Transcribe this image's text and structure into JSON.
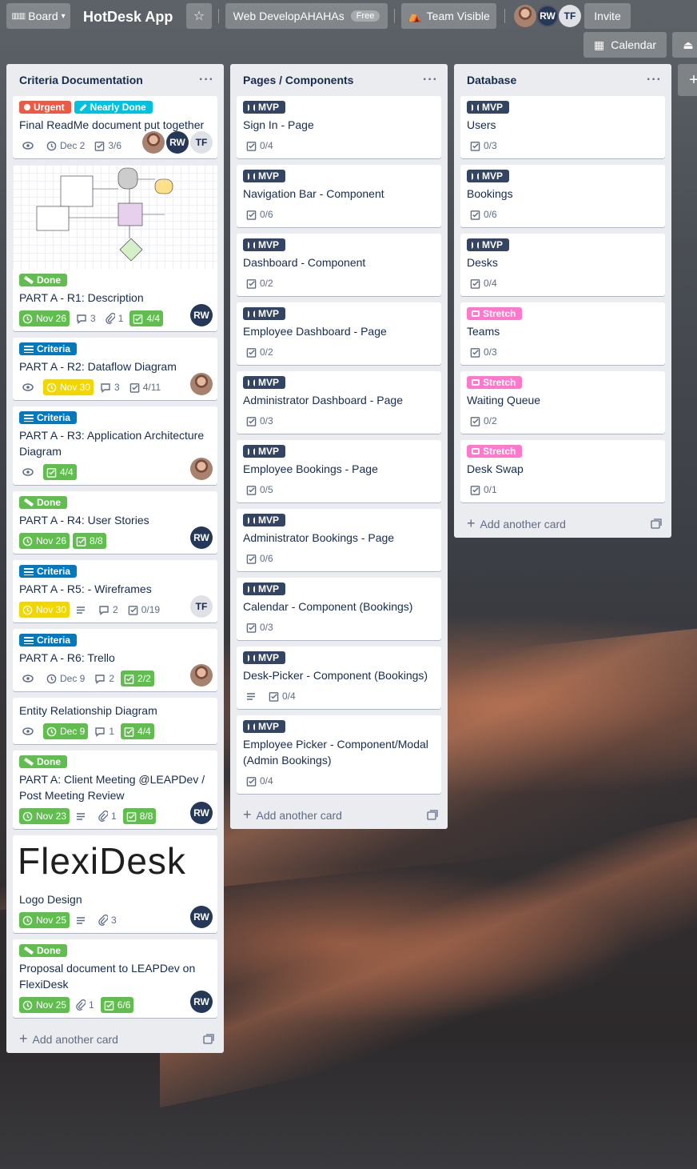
{
  "header": {
    "board_switcher": "Board",
    "board_title": "HotDesk App",
    "workspace": "Web DevelopAHAHAs",
    "workspace_badge": "Free",
    "visibility": "Team Visible",
    "members": [
      "RW",
      "TF"
    ],
    "invite": "Invite",
    "calendar": "Calendar"
  },
  "lists": [
    {
      "title": "Criteria Documentation",
      "add_card": "Add another card",
      "cards": [
        {
          "labels": [
            {
              "text": "Urgent",
              "color": "#eb5a46"
            },
            {
              "text": "Nearly Done",
              "color": "#00c2e0"
            }
          ],
          "title": "Final ReadMe document put together",
          "due": "Dec 2",
          "checklist": "3/6",
          "members": [
            "photo",
            "RW",
            "TF"
          ]
        },
        {
          "cover": "diagram",
          "labels": [
            {
              "text": "Done",
              "color": "#61bd4f"
            }
          ],
          "title": "PART A - R1: Description",
          "due": "Nov 26",
          "comments": "3",
          "attachments": "1",
          "checklist": "4/4",
          "members": [
            "RW"
          ]
        },
        {
          "labels": [
            {
              "text": "Criteria",
              "color": "#0079bf"
            }
          ],
          "title": "PART A - R2: Dataflow Diagram",
          "due": "Nov 30",
          "comments": "3",
          "checklist": "4/11",
          "members": [
            "photo"
          ]
        },
        {
          "labels": [
            {
              "text": "Criteria",
              "color": "#0079bf"
            }
          ],
          "title": "PART A - R3: Application Architecture Diagram",
          "checklist": "4/4",
          "members": [
            "photo"
          ]
        },
        {
          "labels": [
            {
              "text": "Done",
              "color": "#61bd4f"
            }
          ],
          "title": "PART A - R4: User Stories",
          "due": "Nov 26",
          "checklist": "8/8",
          "members": [
            "RW"
          ]
        },
        {
          "labels": [
            {
              "text": "Criteria",
              "color": "#0079bf"
            }
          ],
          "title": "PART A - R5: - Wireframes",
          "due": "Nov 30",
          "comments": "2",
          "checklist": "0/19",
          "members": [
            "TF"
          ]
        },
        {
          "labels": [
            {
              "text": "Criteria",
              "color": "#0079bf"
            }
          ],
          "title": "PART A - R6: Trello",
          "due": "Dec 9",
          "comments": "2",
          "checklist": "2/2",
          "members": [
            "photo"
          ]
        },
        {
          "title": "Entity Relationship Diagram",
          "due": "Dec 9",
          "comments": "1",
          "checklist": "4/4"
        },
        {
          "labels": [
            {
              "text": "Done",
              "color": "#61bd4f"
            }
          ],
          "title": "PART A: Client Meeting @LEAPDev / Post Meeting Review",
          "due": "Nov 23",
          "attachments": "1",
          "checklist": "8/8",
          "members": [
            "RW"
          ]
        },
        {
          "cover": "logo",
          "cover_text": "FlexiDesk",
          "title": "Logo Design",
          "due": "Nov 25",
          "attachments": "3",
          "members": [
            "RW"
          ]
        },
        {
          "labels": [
            {
              "text": "Done",
              "color": "#61bd4f"
            }
          ],
          "title": "Proposal document to LEAPDev on FlexiDesk",
          "due": "Nov 25",
          "attachments": "1",
          "checklist": "6/6",
          "members": [
            "RW"
          ]
        }
      ]
    },
    {
      "title": "Pages / Components",
      "add_card": "Add another card",
      "cards": [
        {
          "labels": [
            {
              "text": "MVP",
              "color": "#344563"
            }
          ],
          "title": "Sign In - Page",
          "checklist": "0/4"
        },
        {
          "labels": [
            {
              "text": "MVP",
              "color": "#344563"
            }
          ],
          "title": "Navigation Bar - Component",
          "checklist": "0/6"
        },
        {
          "labels": [
            {
              "text": "MVP",
              "color": "#344563"
            }
          ],
          "title": "Dashboard - Component",
          "checklist": "0/2"
        },
        {
          "labels": [
            {
              "text": "MVP",
              "color": "#344563"
            }
          ],
          "title": "Employee Dashboard - Page",
          "checklist": "0/2"
        },
        {
          "labels": [
            {
              "text": "MVP",
              "color": "#344563"
            }
          ],
          "title": "Administrator Dashboard - Page",
          "checklist": "0/3"
        },
        {
          "labels": [
            {
              "text": "MVP",
              "color": "#344563"
            }
          ],
          "title": "Employee Bookings - Page",
          "checklist": "0/5"
        },
        {
          "labels": [
            {
              "text": "MVP",
              "color": "#344563"
            }
          ],
          "title": "Administrator Bookings - Page",
          "checklist": "0/6"
        },
        {
          "labels": [
            {
              "text": "MVP",
              "color": "#344563"
            }
          ],
          "title": "Calendar - Component (Bookings)",
          "checklist": "0/3"
        },
        {
          "labels": [
            {
              "text": "MVP",
              "color": "#344563"
            }
          ],
          "title": "Desk-Picker - Component (Bookings)",
          "description": true,
          "checklist": "0/4"
        },
        {
          "labels": [
            {
              "text": "MVP",
              "color": "#344563"
            }
          ],
          "title": "Employee Picker - Component/Modal (Admin Bookings)",
          "checklist": "0/4"
        }
      ]
    },
    {
      "title": "Database",
      "add_card": "Add another card",
      "cards": [
        {
          "labels": [
            {
              "text": "MVP",
              "color": "#344563"
            }
          ],
          "title": "Users",
          "checklist": "0/3"
        },
        {
          "labels": [
            {
              "text": "MVP",
              "color": "#344563"
            }
          ],
          "title": "Bookings",
          "checklist": "0/6"
        },
        {
          "labels": [
            {
              "text": "MVP",
              "color": "#344563"
            }
          ],
          "title": "Desks",
          "checklist": "0/4"
        },
        {
          "labels": [
            {
              "text": "Stretch",
              "color": "#ff78cb"
            }
          ],
          "title": "Teams",
          "checklist": "0/3"
        },
        {
          "labels": [
            {
              "text": "Stretch",
              "color": "#ff78cb"
            }
          ],
          "title": "Waiting Queue",
          "checklist": "0/2"
        },
        {
          "labels": [
            {
              "text": "Stretch",
              "color": "#ff78cb"
            }
          ],
          "title": "Desk Swap",
          "checklist": "0/1"
        }
      ]
    }
  ]
}
